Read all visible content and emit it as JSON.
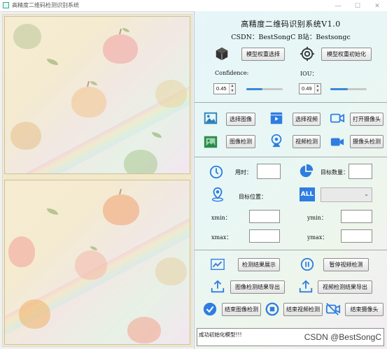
{
  "window": {
    "title": "高精度二维码检测识别系统",
    "min": "—",
    "max": "☐",
    "close": "✕"
  },
  "header": {
    "title": "高精度二维码识别系统V1.0",
    "csdn_line": "CSDN：BestSongC   B站：Bestsongc"
  },
  "model": {
    "select_label": "模型权重选择",
    "init_label": "模型权重初始化"
  },
  "params": {
    "confidence_label": "Confidence:",
    "confidence_value": "0.45",
    "confidence_level": 0.45,
    "iou_label": "IOU：",
    "iou_value": "0.49",
    "iou_level": 0.49
  },
  "source": {
    "select_image": "选择图像",
    "select_video": "选择视频",
    "open_camera": "打开摄像头",
    "image_detect": "图像检测",
    "video_detect": "视频检测",
    "camera_detect": "摄像头检测"
  },
  "info": {
    "time_label": "用时：",
    "target_count_label": "目标数量：",
    "target_pos_label": "目标位置：",
    "xmin_label": "xmin：",
    "ymin_label": "ymin：",
    "xmax_label": "xmax：",
    "ymax_label": "ymax：",
    "all_icon_text": "ALL"
  },
  "results": {
    "show_result": "检测结果展示",
    "pause_video": "暂停视频检测",
    "export_image": "图像检测结果导出",
    "export_video": "视频检测结果导出",
    "end_image": "结束图像检测",
    "end_video": "结束视频检测",
    "end_camera": "结束摄像头"
  },
  "status": {
    "message": "成功初始化模型!!!"
  },
  "watermark": "CSDN @BestSongC",
  "colors": {
    "accent": "#2f7de1",
    "icon_teal": "#2a7fb8",
    "dark_icon": "#333333"
  }
}
